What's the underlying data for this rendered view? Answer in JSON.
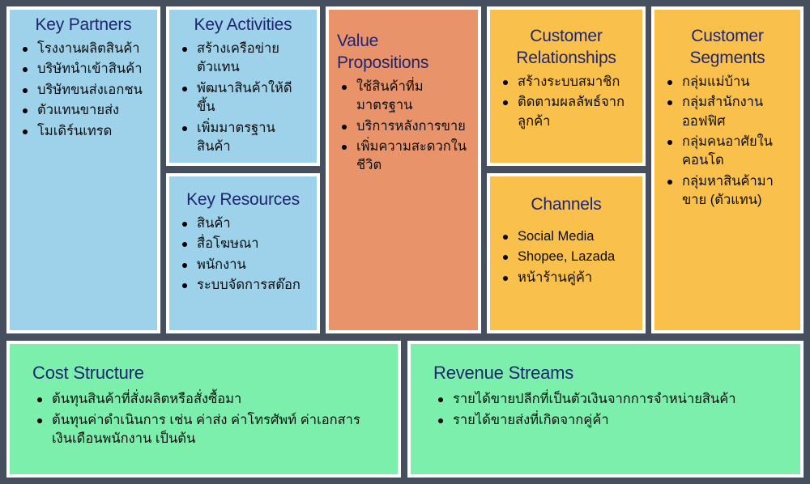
{
  "canvas": {
    "name": "Business Model Canvas",
    "colors": {
      "background": "#464f5e",
      "partner_blue": "#9ed2ea",
      "value_orange": "#e8936a",
      "customer_yellow": "#f9c04c",
      "finance_green": "#7defad",
      "title_text": "#1f2570",
      "body_text": "#0c0c0c",
      "panel_border": "#ffffff"
    }
  },
  "blocks": {
    "key_partners": {
      "title": "Key Partners",
      "items": [
        "โรงงานผลิตสินค้า",
        "บริษัทนำเข้าสินค้า",
        "บริษัทขนส่งเอกชน",
        "ตัวแทนขายส่ง",
        "โมเดิร์นเทรด"
      ]
    },
    "key_activities": {
      "title": "Key Activities",
      "items": [
        "สร้างเครือข่ายตัวแทน",
        "พัฒนาสินค้าให้ดีขึ้น",
        "เพิ่มมาตรฐานสินค้า"
      ]
    },
    "key_resources": {
      "title": "Key Resources",
      "items": [
        "สินค้า",
        "สื่อโฆษณา",
        "พนักงาน",
        "ระบบจัดการสต๊อก"
      ]
    },
    "value_propositions": {
      "title": "Value Propositions",
      "items": [
        "ใช้สินค้าที่มมาตรฐาน",
        "บริการหลังการขาย",
        "เพิ่มความสะดวกในชีวิต"
      ]
    },
    "customer_relationships": {
      "title": "Customer Relationships",
      "items": [
        "สร้างระบบสมาชิก",
        "ติดตามผลลัพธ์จากลูกค้า"
      ]
    },
    "channels": {
      "title": "Channels",
      "items": [
        "Social Media",
        "Shopee, Lazada",
        "หน้าร้านคู่ค้า"
      ]
    },
    "customer_segments": {
      "title": "Customer Segments",
      "items": [
        "กลุ่มแม่บ้าน",
        "กลุ่มสำนักงานออฟฟิศ",
        "กลุ่มคนอาศัยในคอนโด",
        "กลุ่มหาสินค้ามาขาย (ตัวแทน)"
      ]
    },
    "cost_structure": {
      "title": "Cost Structure",
      "items": [
        "ต้นทุนสินค้าที่สั่งผลิตหรือสั่งซื้อมา",
        "ต้นทุนค่าดำเนินการ เช่น ค่าส่ง ค่าโทรศัพท์ ค่าเอกสาร เงินเดือนพนักงาน เป็นต้น"
      ]
    },
    "revenue_streams": {
      "title": "Revenue Streams",
      "items": [
        "รายได้ขายปลีกที่เป็นตัวเงินจากการจำหน่ายสินค้า",
        "รายได้ขายส่งที่เกิดจากคู่ค้า"
      ]
    }
  }
}
